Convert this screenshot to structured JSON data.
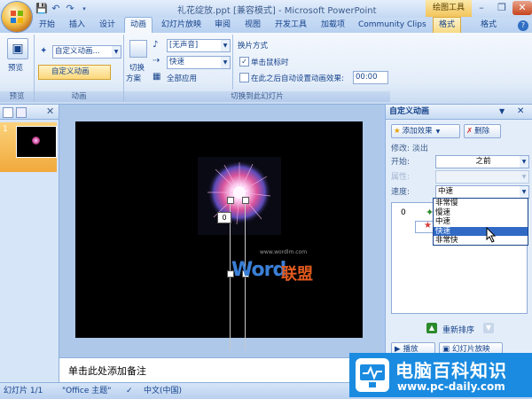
{
  "window": {
    "title": "礼花绽放.ppt [兼容模式] - Microsoft PowerPoint"
  },
  "context_tab": "绘图工具",
  "tabs": [
    "开始",
    "插入",
    "设计",
    "动画",
    "幻灯片放映",
    "审阅",
    "视图",
    "开发工具",
    "加载项",
    "Community Clips",
    "格式",
    "格式"
  ],
  "ribbon": {
    "preview_label": "预览",
    "preview_group": "预览",
    "anim_combo_value": "自定义动画...",
    "custom_anim_btn": "自定义动画",
    "anim_group": "动画",
    "switch_scheme_label1": "切换",
    "switch_scheme_label2": "方案",
    "sound_value": "[无声音]",
    "speed_value": "快速",
    "apply_all": "全部应用",
    "advance_title": "换片方式",
    "on_click": "单击鼠标时",
    "after_auto": "在此之后自动设置动画效果:",
    "time_value": "00:00",
    "transition_group": "切换到此幻灯片"
  },
  "thumbnails": {
    "slide_number": "1"
  },
  "slide": {
    "trigger_tag": "0",
    "watermark_word": "Word",
    "watermark_cn": "联盟",
    "watermark_url": "www.wordlm.com"
  },
  "notes": {
    "placeholder": "单击此处添加备注"
  },
  "custom_animation_pane": {
    "title": "自定义动画",
    "add_effect": "添加效果",
    "remove": "删除",
    "modify": "修改: 淡出",
    "start_label": "开始:",
    "start_value": "之前",
    "property_label": "属性:",
    "speed_label": "速度:",
    "speed_value": "中速",
    "speed_options": [
      "非常慢",
      "慢速",
      "中速",
      "快速",
      "非常快"
    ],
    "highlighted_option": 3,
    "list_index": "0",
    "reorder": "重新排序",
    "play": "播放",
    "slideshow": "幻灯片放映"
  },
  "status": {
    "slide_info": "幻灯片 1/1",
    "theme": "\"Office 主题\"",
    "language": "中文(中国)"
  },
  "brand": {
    "name": "电脑百科知识",
    "url": "www.pc-daily.com"
  },
  "colors": {
    "accent": "#15428b",
    "ribbon": "#e3edf9",
    "highlight": "#316ac5"
  }
}
